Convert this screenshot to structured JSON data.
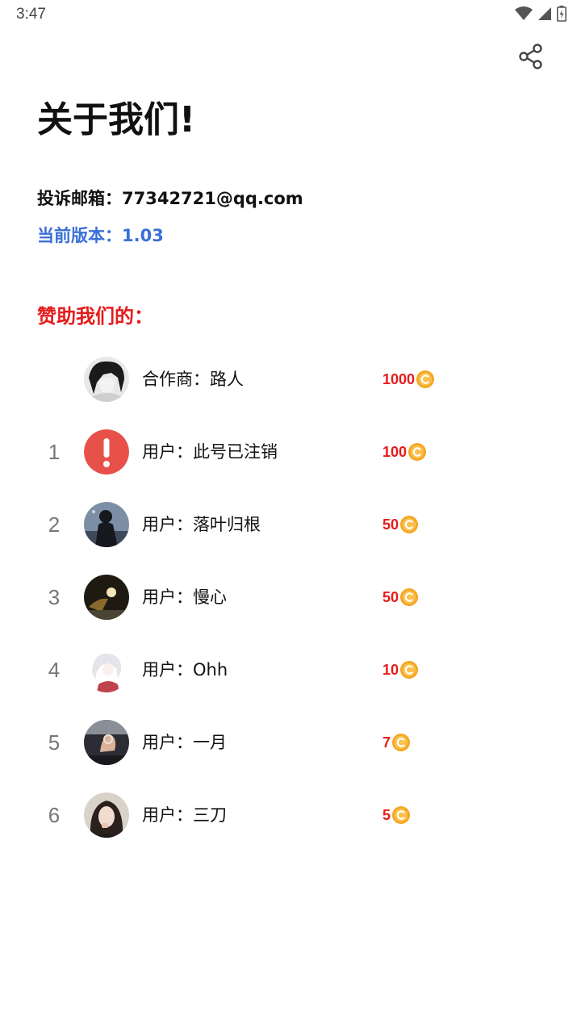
{
  "status_bar": {
    "time": "3:47"
  },
  "header": {
    "share_icon": "share-icon"
  },
  "page": {
    "title": "关于我们!",
    "email_line": "投诉邮箱：77342721@qq.com",
    "version_line": "当前版本：1.03",
    "sponsor_heading": "赞助我们的："
  },
  "colors": {
    "accent_blue": "#3a6fd8",
    "accent_red": "#e51c1c"
  },
  "sponsors": [
    {
      "rank": "",
      "name": "合作商：路人",
      "amount": "1000",
      "avatar": "dark-hair-anime-avatar"
    },
    {
      "rank": "1",
      "name": "用户：此号已注销",
      "amount": "100",
      "avatar": "alert-icon-avatar"
    },
    {
      "rank": "2",
      "name": "用户：落叶归根",
      "amount": "50",
      "avatar": "dark-figure-avatar"
    },
    {
      "rank": "3",
      "name": "用户：慢心",
      "amount": "50",
      "avatar": "night-light-avatar"
    },
    {
      "rank": "4",
      "name": "用户：Ohh",
      "amount": "10",
      "avatar": "white-hair-anime-avatar"
    },
    {
      "rank": "5",
      "name": "用户：一月",
      "amount": "7",
      "avatar": "hand-photo-avatar"
    },
    {
      "rank": "6",
      "name": "用户：三刀",
      "amount": "5",
      "avatar": "girl-portrait-avatar"
    }
  ]
}
